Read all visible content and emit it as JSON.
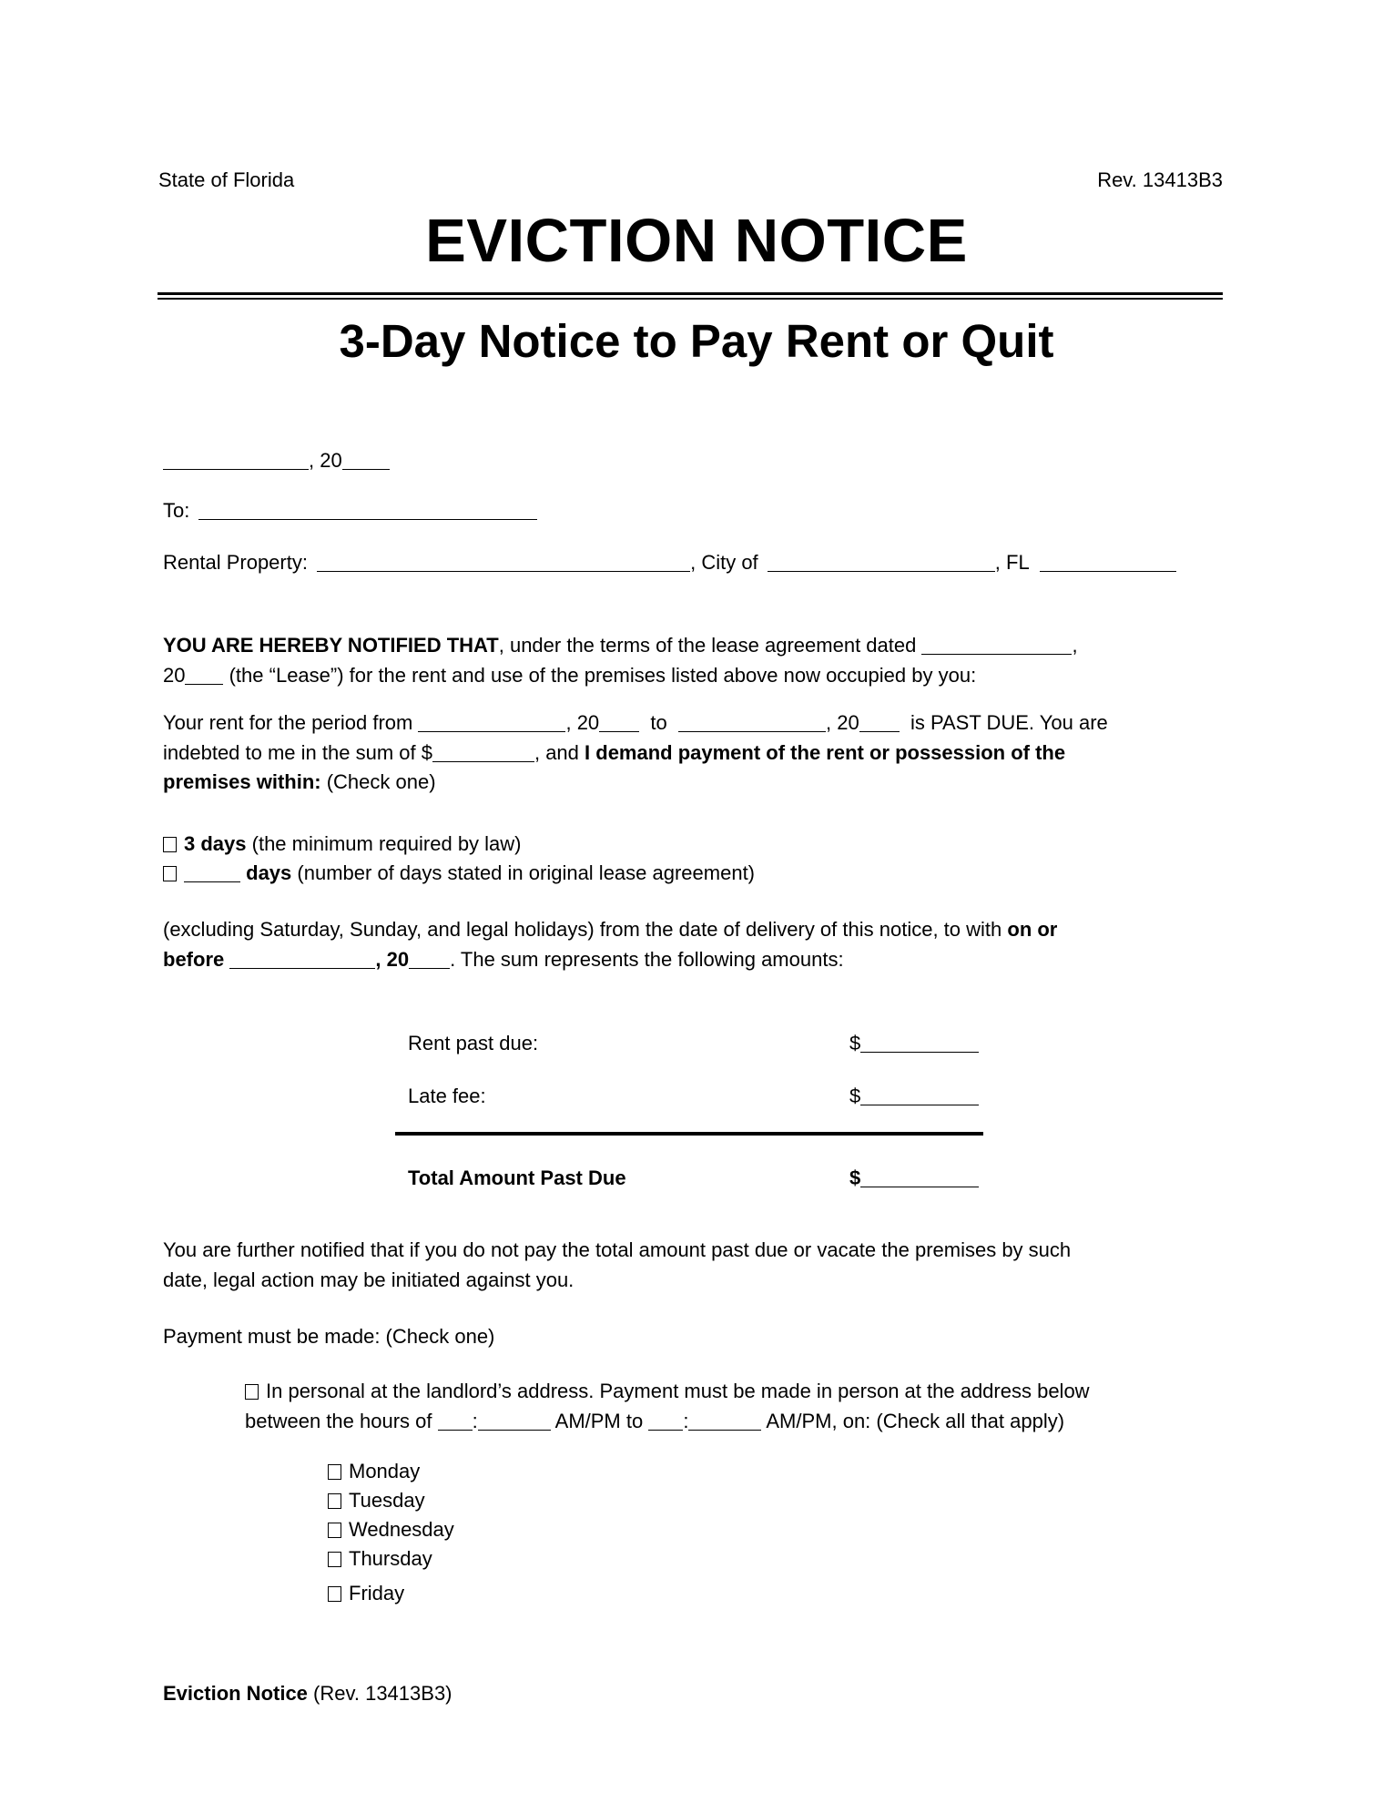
{
  "header": {
    "state": "State of Florida",
    "revision": "Rev. 13413B3",
    "title": "EVICTION NOTICE",
    "subtitle": "3-Day Notice to Pay Rent or Quit"
  },
  "fields": {
    "date_suffix": ", 20",
    "to_label": "To:",
    "rental_property_label": "Rental Property:",
    "city_label": ", City of",
    "state_label": ", FL"
  },
  "notice": {
    "intro_bold": "YOU ARE HEREBY NOTIFIED THAT",
    "intro_text": ", under the terms of the lease agreement dated",
    "intro_comma": ",",
    "line2_year": "20",
    "line2_text": "(the “Lease”) for the rent and use of the premises listed above now occupied by you:"
  },
  "rent": {
    "from_text": "Your rent for the period from",
    "year1": ", 20",
    "to_text": "to",
    "year2": ", 20",
    "past_due": "is PAST DUE. You are",
    "indebted": "indebted to me in the sum of $",
    "and_text": ", and",
    "demand_bold": "I demand payment of the rent or possession of the",
    "premises_bold": "premises within:",
    "check_one": "(Check one)"
  },
  "options": [
    {
      "bold": "3 days",
      "text": "(the minimum required by law)",
      "checked": false
    },
    {
      "bold": "days",
      "text": "(number of days stated in original lease agreement)",
      "checked": false
    }
  ],
  "excluding": {
    "text": "(excluding Saturday, Sunday, and legal holidays) from the date of delivery of this notice, to with",
    "on_or": "on or",
    "before": "before",
    "year": ", 20",
    "after": ". The sum represents the following amounts:"
  },
  "amounts": {
    "rows": [
      {
        "label": "Rent past due:",
        "currency": "$"
      },
      {
        "label": "Late fee:",
        "currency": "$"
      }
    ],
    "total": {
      "label": "Total Amount Past Due",
      "currency": "$"
    }
  },
  "further": {
    "line1": "You are further notified that if you do not pay the total amount past due or vacate the premises by such",
    "line2": "date, legal action may be initiated against you."
  },
  "payment": {
    "heading": "Payment must be made: (Check one)",
    "option_line1": "In personal at the landlord’s address. Payment must be made in person at the address below",
    "option_line2_a": "between the hours of",
    "colon": ":",
    "ampm_to": "AM/PM to",
    "ampm_on": "AM/PM, on: (Check all that apply)",
    "days": [
      "Monday",
      "Tuesday",
      "Wednesday",
      "Thursday",
      "Friday"
    ]
  },
  "footer": {
    "bold": "Eviction Notice",
    "text": "(Rev. 13413B3)"
  }
}
